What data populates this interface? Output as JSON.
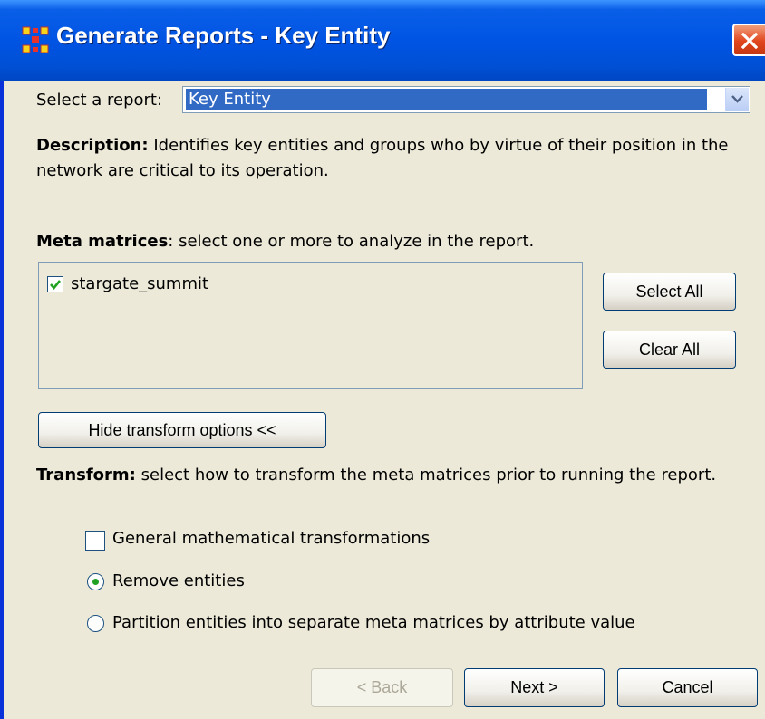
{
  "window": {
    "title": "Generate Reports - Key Entity",
    "close_label": "Close"
  },
  "report_selector": {
    "label": "Select a report:",
    "selected": "Key Entity"
  },
  "description": {
    "heading": "Description:",
    "text": " Identifies key entities and groups who by virtue of their position in the network are critical to its operation."
  },
  "meta_matrices": {
    "heading": "Meta matrices",
    "text": ": select one or more to analyze in the report.",
    "items": [
      {
        "label": "stargate_summit",
        "checked": true
      }
    ],
    "select_all_label": "Select All",
    "clear_all_label": "Clear All"
  },
  "transform_toggle_label": "Hide transform options <<",
  "transform": {
    "heading": "Transform:",
    "text": " select how to transform the meta matrices prior to running the report.",
    "options": [
      {
        "label": "General mathematical transformations",
        "kind": "checkbox",
        "checked": false
      },
      {
        "label": "Remove entities",
        "kind": "radio",
        "selected": true
      },
      {
        "label": "Partition entities into separate meta matrices by attribute value",
        "kind": "radio",
        "selected": false
      }
    ]
  },
  "footer": {
    "back_label": "< Back",
    "next_label": "Next >",
    "cancel_label": "Cancel"
  },
  "colors": {
    "title_bar": "#0054e3",
    "dialog_bg": "#ece9d8",
    "selection": "#316ac5",
    "check_green": "#21a121",
    "close_red": "#e0461d"
  }
}
